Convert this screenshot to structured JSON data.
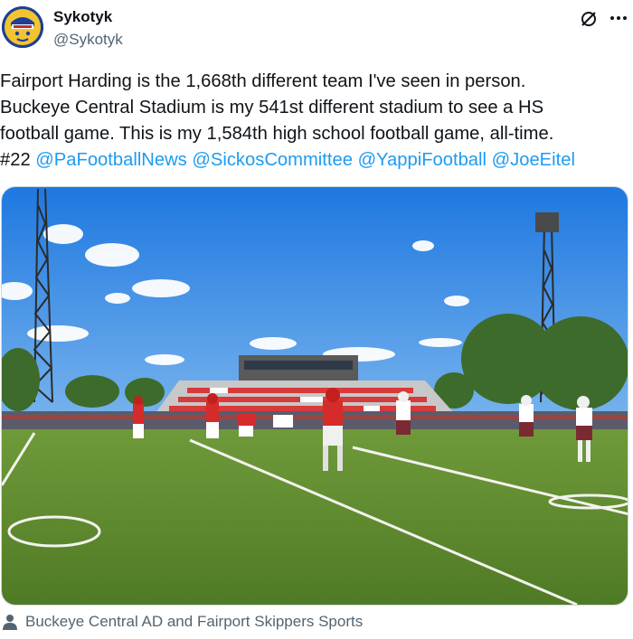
{
  "author": {
    "name": "Sykotyk",
    "handle": "@Sykotyk",
    "avatar_icon": "rocket-face-avatar-icon"
  },
  "tweet": {
    "lines": [
      "Fairport Harding is the 1,668th different team I've seen in person.",
      "Buckeye Central Stadium is my 541st different stadium to see a HS",
      "football game. This is my 1,584th high school football game, all-time."
    ],
    "hashtag": "#22",
    "mentions": [
      "@PaFootballNews",
      "@SickosCommittee",
      "@YappiFootball",
      "@JoeEitel"
    ]
  },
  "media": {
    "description_icon": "football-game-photo"
  },
  "credit": {
    "text": "Buckeye Central AD and Fairport Skippers Sports",
    "icon": "person-icon"
  },
  "colors": {
    "link": "#1d9bf0",
    "secondary_text": "#536471",
    "primary_text": "#0f1419"
  }
}
